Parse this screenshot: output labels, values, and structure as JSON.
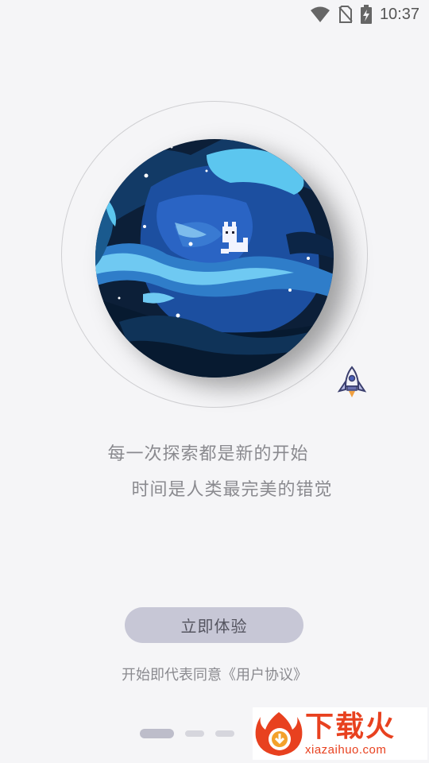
{
  "status_bar": {
    "time": "10:37",
    "icons": [
      "wifi-icon",
      "no-sim-icon",
      "battery-charging-icon"
    ]
  },
  "intro": {
    "tagline_1": "每一次探索都是新的开始",
    "tagline_2": "时间是人类最完美的错觉"
  },
  "actions": {
    "start_label": "立即体验",
    "agreement_prefix": "开始即代表同意",
    "agreement_link": "《用户协议》"
  },
  "pager": {
    "total": 3,
    "active": 0
  },
  "watermark": {
    "name": "下载火",
    "url": "xiazaihuo.com"
  },
  "colors": {
    "background": "#f5f5f7",
    "button": "#c7c7d6",
    "text": "#8a8a8f",
    "watermark": "#e8411f"
  }
}
